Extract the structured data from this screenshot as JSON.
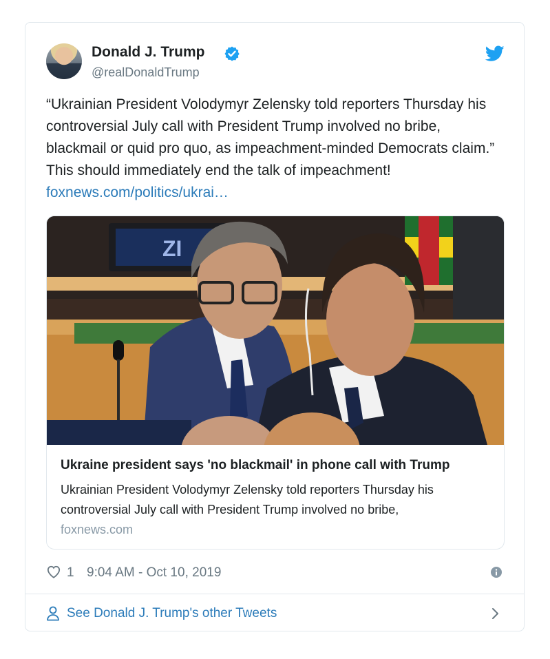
{
  "tweet": {
    "author_name": "Donald J. Trump",
    "handle": "@realDonaldTrump",
    "text": "“Ukrainian President Volodymyr Zelensky told reporters Thursday his controversial July call with President Trump involved no bribe, blackmail or quid pro quo, as impeachment-minded Democrats claim.” This should immediately end the talk of impeachment! ",
    "link_text": "foxnews.com/politics/ukrai…",
    "likes": "1",
    "timestamp": "9:04 AM - Oct 10, 2019"
  },
  "link_card": {
    "title": "Ukraine president says 'no blackmail' in phone call with Trump",
    "description": "Ukrainian President Volodymyr Zelensky told reporters Thursday his controversial July call with President Trump involved no bribe,",
    "domain": "foxnews.com",
    "photo_sign_text": "ZI"
  },
  "footer": {
    "label": "See Donald J. Trump's other Tweets"
  },
  "icons": {
    "verified": "verified-badge-icon",
    "brand": "twitter-bird-icon",
    "like": "heart-icon",
    "info": "info-icon",
    "profile": "person-icon",
    "chevron": "chevron-right-icon"
  },
  "colors": {
    "link": "#2b7bb9",
    "twitter_blue": "#1da1f2",
    "secondary_text": "#697882",
    "border": "#e1e8ed"
  }
}
